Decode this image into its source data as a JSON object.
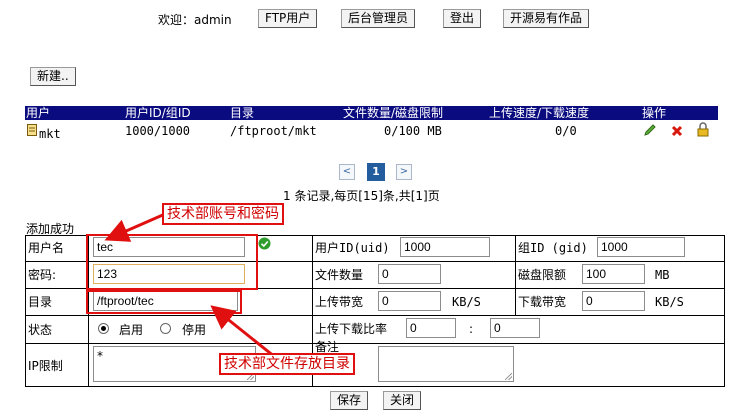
{
  "topbar": {
    "welcome": "欢迎：admin",
    "buttons": [
      "FTP用户",
      "后台管理员",
      "登出",
      "开源易有作品"
    ]
  },
  "toolbar": {
    "new_label": "新建.."
  },
  "table": {
    "headers": [
      "用户",
      "用户ID/组ID",
      "目录",
      "文件数量/磁盘限制",
      "上传速度/下载速度",
      "操作"
    ],
    "rows": [
      {
        "user": "mkt",
        "ids": "1000/1000",
        "dir": "/ftproot/mkt",
        "quota": "0/100 MB",
        "speed": "0/0"
      }
    ],
    "row_icons": [
      "user-file-icon",
      "edit-pencil-icon",
      "delete-x-icon",
      "lock-icon"
    ]
  },
  "pagination": {
    "prev": "<",
    "current": "1",
    "next": ">",
    "summary": "1 条记录,每页[15]条,共[1]页"
  },
  "form": {
    "status_message": "添加成功",
    "labels": {
      "username": "用户名",
      "password": "密码:",
      "dir": "目录",
      "status": "状态",
      "ip": "IP限制",
      "uid": "用户ID(uid)",
      "gid": "组ID (gid)",
      "file_count": "文件数量",
      "disk_quota": "磁盘限额",
      "upload_bw": "上传带宽",
      "download_bw": "下载带宽",
      "ratio": "上传下载比率",
      "note": "备注"
    },
    "values": {
      "username": "tec",
      "password": "123",
      "dir": "/ftproot/tec",
      "ip": "*",
      "uid": "1000",
      "gid": "1000",
      "file_count": "0",
      "disk_quota": "100",
      "upload_bw": "0",
      "download_bw": "0",
      "ratio_up": "0",
      "ratio_down": "0"
    },
    "units": {
      "mb": "MB",
      "kbs": "KB/S",
      "colon": ":"
    },
    "status_options": [
      "启用",
      "停用"
    ],
    "status_selected": "启用",
    "save_label": "保存",
    "close_label": "关闭"
  },
  "annotations": {
    "account": "技术部账号和密码",
    "directory": "技术部文件存放目录"
  },
  "colors": {
    "header_bg": "#0b0b80",
    "annotation_red": "#e01010",
    "valid_green": "#2e9d2e"
  }
}
